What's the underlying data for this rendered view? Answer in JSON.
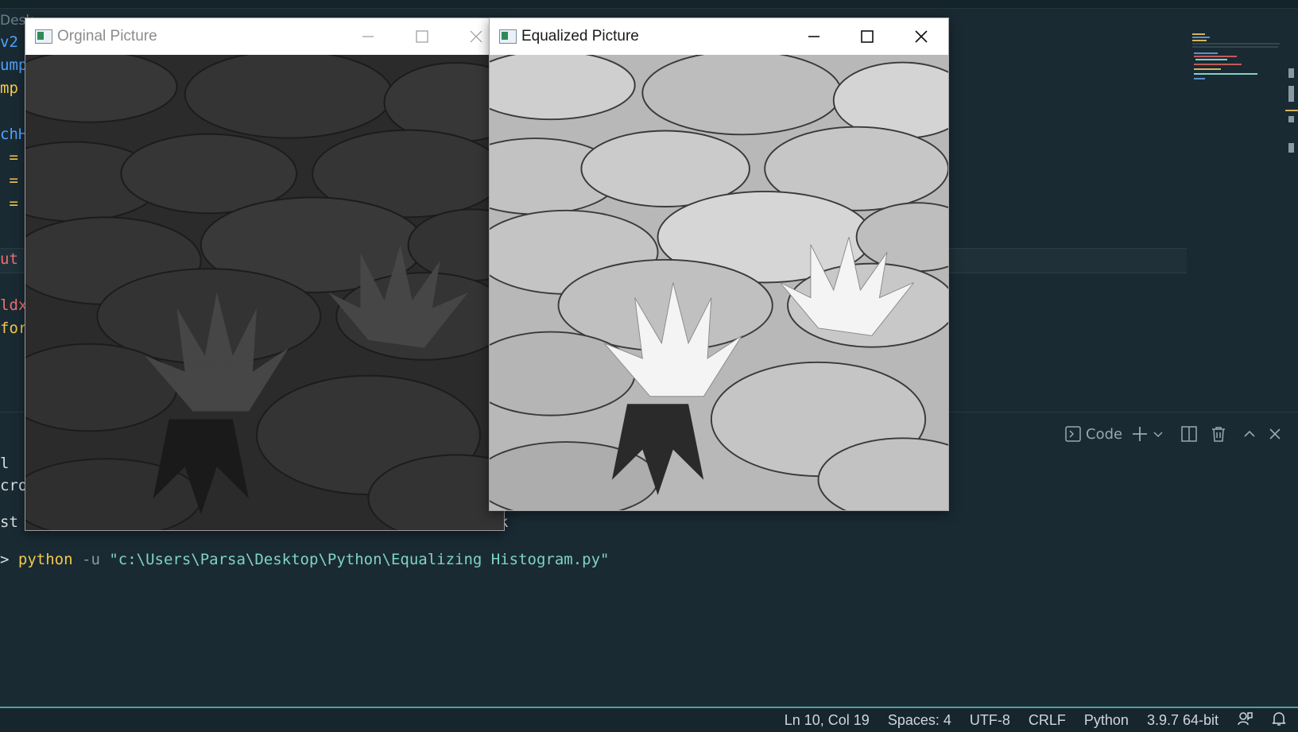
{
  "editor": {
    "breadcrumb": "Desk",
    "code_fragments": [
      {
        "text": "v2",
        "color": "#4fa3ff"
      },
      {
        "text": "ump",
        "color": "#4fa3ff"
      },
      {
        "text": "mp",
        "color": "#f2c94c"
      },
      {
        "text": "chH",
        "color": "#4fa3ff"
      },
      {
        "text": " =",
        "color": "#f2c94c"
      },
      {
        "text": " =",
        "color": "#f2c94c"
      },
      {
        "text": " =",
        "color": "#f2c94c"
      },
      {
        "text": "ut",
        "color": "#f07070"
      },
      {
        "text": "ldx",
        "color": "#f07070"
      },
      {
        "text": "for",
        "color": "#f2c94c"
      }
    ]
  },
  "terminal": {
    "fragments": [
      "l",
      "cros",
      "st F",
      "k"
    ],
    "prompt": ">",
    "command": "python",
    "flag": "-u",
    "argument": "\"c:\\Users\\Parsa\\Desktop\\Python\\Equalizing Histogram.py\""
  },
  "panel_toolbar": {
    "code_label": "Code",
    "icons": [
      "terminal-icon",
      "plus-icon",
      "chevron-down-icon",
      "split-icon",
      "trash-icon",
      "chevron-up-icon",
      "close-icon"
    ]
  },
  "windows": {
    "original": {
      "title": "Orginal Picture",
      "state": "inactive"
    },
    "equalized": {
      "title": "Equalized Picture",
      "state": "active"
    }
  },
  "statusbar": {
    "items": [
      "Ln 10, Col 19",
      "Spaces: 4",
      "UTF-8",
      "CRLF",
      "Python",
      "3.9.7 64-bit"
    ],
    "icons": [
      "feedback-icon",
      "bell-icon"
    ]
  },
  "colors": {
    "editor_bg": "#1a2a33",
    "statusbar_border": "#4aa3a0",
    "string": "#7fd3c6",
    "keyword": "#f2c94c"
  }
}
